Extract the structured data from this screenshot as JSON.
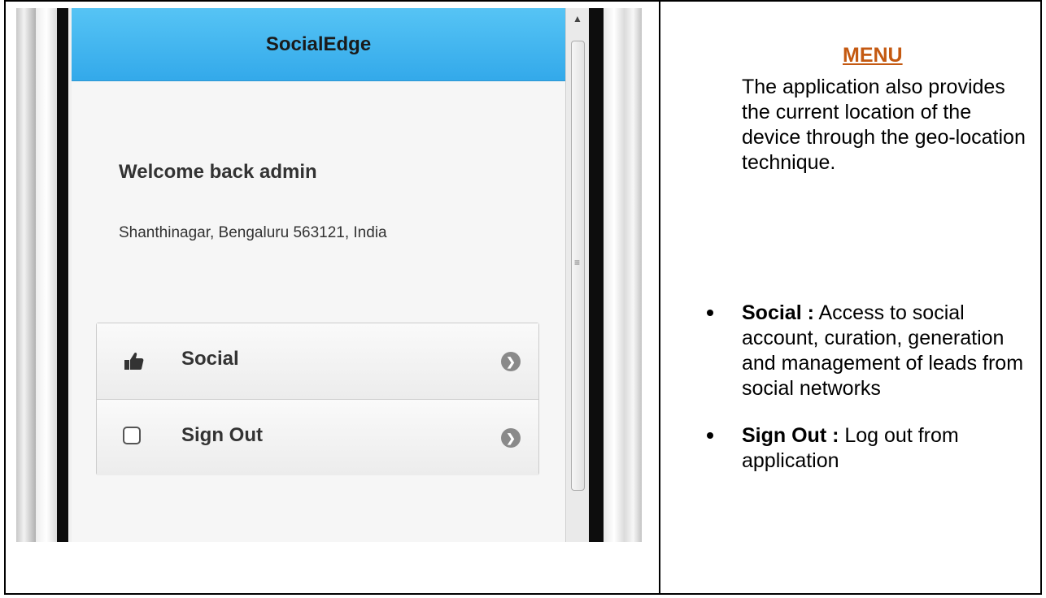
{
  "app": {
    "title": "SocialEdge",
    "welcome": "Welcome back admin",
    "location": "Shanthinagar, Bengaluru 563121, India",
    "menu": [
      {
        "label": "Social",
        "icon": "thumbs-up-icon"
      },
      {
        "label": "Sign Out",
        "icon": "checkbox-icon"
      }
    ],
    "header_color": "#3db2ef"
  },
  "doc": {
    "heading": "MENU",
    "description": "The application also provides the current location of the device through the geo-location technique.",
    "bullets": [
      {
        "term": "Social :",
        "text": " Access to social account, curation, generation and management of leads from social networks"
      },
      {
        "term": "Sign Out :",
        "text": " Log out  from application"
      }
    ],
    "heading_color": "#c45911"
  }
}
